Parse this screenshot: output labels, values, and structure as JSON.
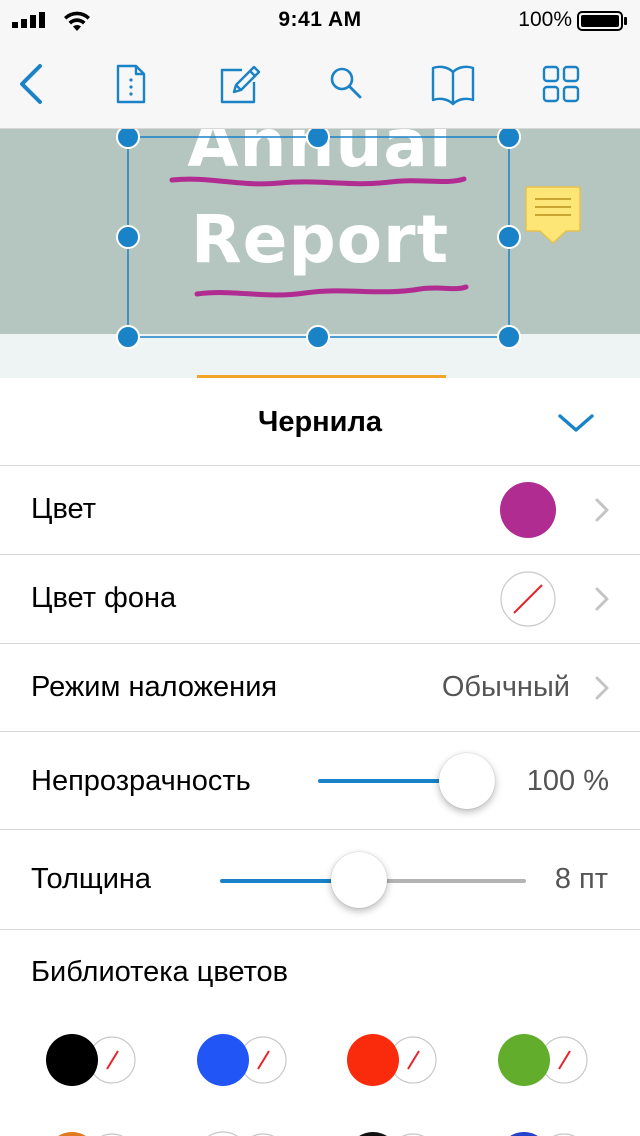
{
  "status_bar": {
    "time": "9:41 AM",
    "battery_percent": "100%"
  },
  "toolbar": {
    "icons": [
      "back-chevron-icon",
      "document-outline-icon",
      "edit-pencil-icon",
      "search-icon",
      "book-icon",
      "grid-icon"
    ]
  },
  "document": {
    "title_line1": "Annual",
    "title_line2": "Report",
    "note_color": "#fde676",
    "ink_color": "#b02c91",
    "selection_color": "#1a82c6"
  },
  "panel": {
    "title": "Чернила",
    "rows": {
      "color": {
        "label": "Цвет",
        "value_color": "#b02c91"
      },
      "fill_color": {
        "label": "Цвет фона",
        "value": "none"
      },
      "blend_mode": {
        "label": "Режим наложения",
        "value": "Обычный"
      },
      "opacity": {
        "label": "Непрозрачность",
        "value_text": "100 %",
        "fraction": 1.0
      },
      "thickness": {
        "label": "Толщина",
        "value_text": "8 пт",
        "fraction": 0.36
      }
    },
    "library": {
      "title": "Библиотека цветов",
      "swatches": [
        {
          "stroke": "#000000",
          "fill": "none"
        },
        {
          "stroke": "#2255f5",
          "fill": "none"
        },
        {
          "stroke": "#fa2a0c",
          "fill": "none"
        },
        {
          "stroke": "#62ad2b",
          "fill": "none"
        }
      ],
      "partial_swatches": [
        "#e07a20",
        "#ffffff",
        "#111111",
        "#2244cc"
      ]
    }
  },
  "colors": {
    "accent": "#1a82c6",
    "tab_indicator": "#f0a526",
    "separator": "#d8d8d8",
    "slider_inactive": "#b4b4b4"
  }
}
